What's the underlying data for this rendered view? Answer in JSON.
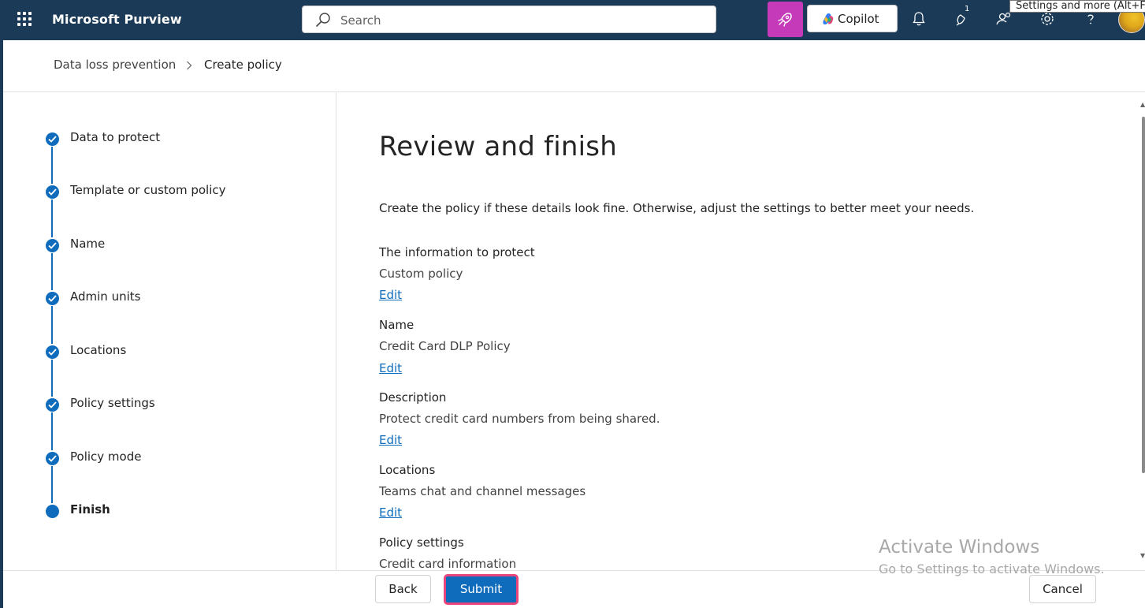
{
  "header": {
    "app_title": "Microsoft Purview",
    "search_placeholder": "Search",
    "copilot_label": "Copilot",
    "notification_badge": "1",
    "tooltip": "Settings and more (Alt+F)",
    "icons": [
      "app-launcher-icon",
      "search-icon",
      "developer-rocket-icon",
      "copilot-logo-icon",
      "bell-icon",
      "feedback-icon",
      "people-icon",
      "gear-icon",
      "help-icon",
      "avatar"
    ]
  },
  "breadcrumb": {
    "items": [
      "Data loss prevention",
      "Create policy"
    ]
  },
  "steps": [
    {
      "label": "Data to protect",
      "state": "complete"
    },
    {
      "label": "Template or custom policy",
      "state": "complete"
    },
    {
      "label": "Name",
      "state": "complete"
    },
    {
      "label": "Admin units",
      "state": "complete"
    },
    {
      "label": "Locations",
      "state": "complete"
    },
    {
      "label": "Policy settings",
      "state": "complete"
    },
    {
      "label": "Policy mode",
      "state": "complete"
    },
    {
      "label": "Finish",
      "state": "current"
    }
  ],
  "main": {
    "title": "Review and finish",
    "intro": "Create the policy if these details look fine. Otherwise, adjust the settings to better meet your needs.",
    "edit_label": "Edit",
    "sections": [
      {
        "heading": "The information to protect",
        "value": "Custom policy"
      },
      {
        "heading": "Name",
        "value": "Credit Card DLP Policy"
      },
      {
        "heading": "Description",
        "value": "Protect credit card numbers from being shared."
      },
      {
        "heading": "Locations",
        "value": "Teams chat and channel messages"
      },
      {
        "heading": "Policy settings",
        "value": "Credit card information"
      }
    ]
  },
  "footer": {
    "back_label": "Back",
    "submit_label": "Submit",
    "cancel_label": "Cancel"
  },
  "watermark": {
    "line1": "Activate Windows",
    "line2": "Go to Settings to activate Windows."
  },
  "colors": {
    "topbar": "#1b3a57",
    "accent": "#0f6cbd",
    "developer_button": "#c43ab8",
    "submit_highlight": "#e8457c"
  }
}
